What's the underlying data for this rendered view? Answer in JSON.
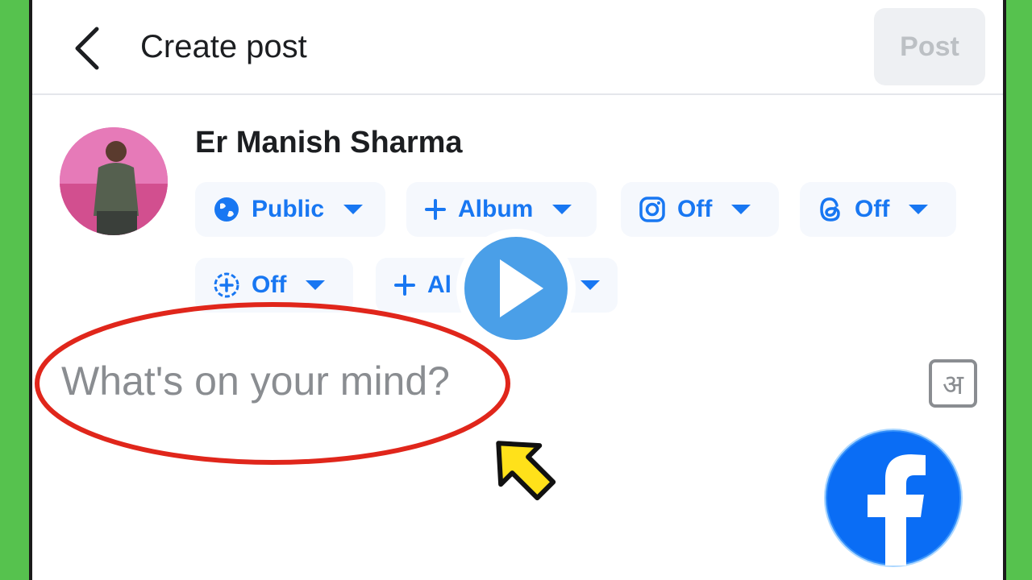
{
  "header": {
    "title": "Create post",
    "post_label": "Post"
  },
  "user": {
    "name": "Er Manish Sharma"
  },
  "chips_row1": [
    {
      "label": "Public",
      "icon": "globe-icon"
    },
    {
      "label": "Album",
      "icon": "plus-icon"
    },
    {
      "label": "Off",
      "icon": "instagram-icon"
    },
    {
      "label": "Off",
      "icon": "threads-icon"
    }
  ],
  "chips_row2": [
    {
      "label": "Off",
      "icon": "story-add-icon"
    },
    {
      "label": "Al",
      "icon": "plus-icon"
    }
  ],
  "composer": {
    "placeholder": "What's on your mind?"
  },
  "lang_toggle": {
    "label": "अ"
  },
  "colors": {
    "accent": "#1877f2",
    "background": "#56c24e",
    "annotation_circle": "#e0261b",
    "arrow": "#ffe11a",
    "play_button": "#4a9fe8"
  }
}
